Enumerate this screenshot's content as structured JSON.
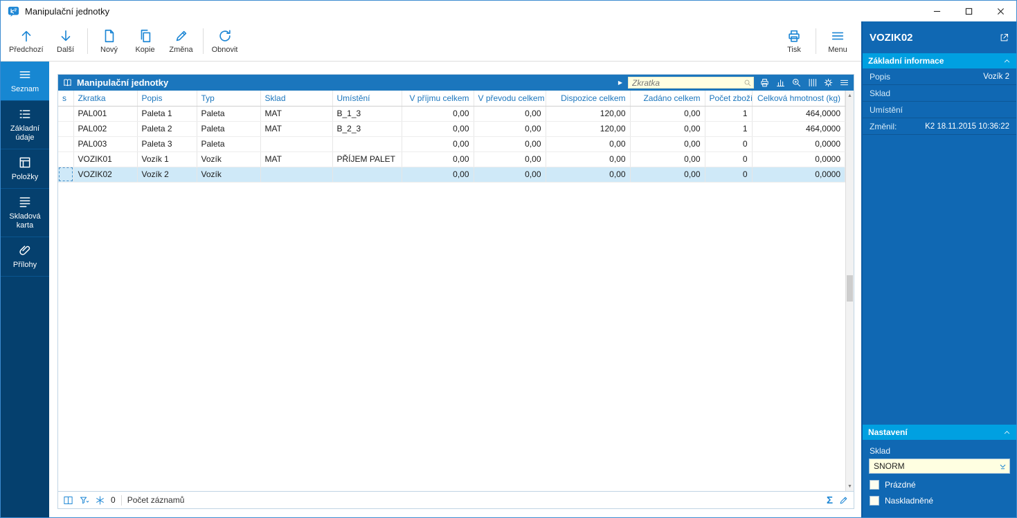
{
  "titlebar": {
    "title": "Manipulační jednotky"
  },
  "toolbar": {
    "buttons": [
      {
        "label": "Předchozí"
      },
      {
        "label": "Další"
      },
      {
        "label": "Nový"
      },
      {
        "label": "Kopie"
      },
      {
        "label": "Změna"
      },
      {
        "label": "Obnovit"
      }
    ],
    "right": [
      {
        "label": "Tisk"
      },
      {
        "label": "Menu"
      }
    ]
  },
  "sidebar": {
    "active_index": 0,
    "items": [
      {
        "label": "Seznam"
      },
      {
        "label": "Základní údaje"
      },
      {
        "label": "Položky"
      },
      {
        "label": "Skladová karta"
      },
      {
        "label": "Přílohy"
      }
    ]
  },
  "grid": {
    "title": "Manipulační jednotky",
    "search": {
      "placeholder": "Zkratka"
    },
    "columns": [
      "s",
      "Zkratka",
      "Popis",
      "Typ",
      "Sklad",
      "Umístění",
      "V příjmu celkem",
      "V převodu celkem",
      "Dispozice celkem",
      "Zadáno celkem",
      "Počet zboží",
      "Celková hmotnost (kg)"
    ],
    "rows": [
      [
        "",
        "PAL001",
        "Paleta 1",
        "Paleta",
        "MAT",
        "B_1_3",
        "0,00",
        "0,00",
        "120,00",
        "0,00",
        "1",
        "464,0000"
      ],
      [
        "",
        "PAL002",
        "Paleta 2",
        "Paleta",
        "MAT",
        "B_2_3",
        "0,00",
        "0,00",
        "120,00",
        "0,00",
        "1",
        "464,0000"
      ],
      [
        "",
        "PAL003",
        "Paleta 3",
        "Paleta",
        "",
        "",
        "0,00",
        "0,00",
        "0,00",
        "0,00",
        "0",
        "0,0000"
      ],
      [
        "",
        "VOZIK01",
        "Vozík 1",
        "Vozík",
        "MAT",
        "PŘÍJEM PALET",
        "0,00",
        "0,00",
        "0,00",
        "0,00",
        "0",
        "0,0000"
      ],
      [
        "",
        "VOZIK02",
        "Vozík 2",
        "Vozík",
        "",
        "",
        "0,00",
        "0,00",
        "0,00",
        "0,00",
        "0",
        "0,0000"
      ]
    ],
    "selected_index": 4,
    "statusbar": {
      "frozen_count": "0",
      "records_label": "Počet záznamů"
    }
  },
  "detail": {
    "title": "VOZIK02",
    "info_section": {
      "title": "Základní informace",
      "fields": [
        {
          "label": "Popis",
          "value": "Vozík 2"
        },
        {
          "label": "Sklad",
          "value": ""
        },
        {
          "label": "Umístění",
          "value": ""
        },
        {
          "label": "Změnil:",
          "value": "K2 18.11.2015 10:36:22"
        }
      ]
    },
    "settings_section": {
      "title": "Nastavení",
      "sklad_label": "Sklad",
      "sklad_value": "SNORM",
      "checkboxes": [
        {
          "label": "Prázdné",
          "checked": false
        },
        {
          "label": "Naskladněné",
          "checked": false
        }
      ]
    }
  },
  "colors": {
    "accent_blue": "#1b76bd",
    "sidebar_bg": "#05406e",
    "sidebar_active": "#1787d2",
    "panel_bg": "#1068b3",
    "section_header": "#00a0e1",
    "selected_row": "#cfe9f8",
    "input_bg": "#ffffe1"
  }
}
